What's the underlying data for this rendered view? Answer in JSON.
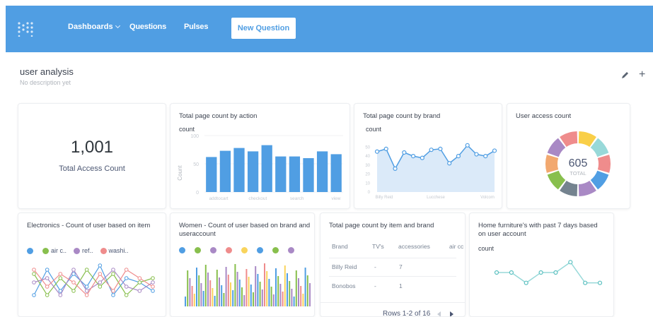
{
  "nav": {
    "dashboards": "Dashboards",
    "questions": "Questions",
    "pulses": "Pulses",
    "new_question": "New Question"
  },
  "dashboard": {
    "title": "user analysis",
    "description": "No description yet"
  },
  "icons": {
    "logo": "metabase-logo-icon",
    "edit": "pencil-icon",
    "add": "plus-icon"
  },
  "cards": {
    "access_count": {
      "value": "1,001",
      "label": "Total Access Count"
    },
    "page_by_action": {
      "title": "Total page count by action",
      "series_label": "count",
      "y_axis_label": "Count",
      "y_ticks": [
        "100",
        "50",
        "0"
      ],
      "x_ticks": [
        "addtocart",
        "checkout",
        "search",
        "view"
      ],
      "values": [
        62,
        73,
        78,
        72,
        83,
        63,
        63,
        60,
        72,
        67
      ]
    },
    "page_by_brand": {
      "title": "Total page count by brand",
      "series_label": "count",
      "y_ticks": [
        "50",
        "40",
        "30",
        "20",
        "10",
        "0"
      ],
      "x_ticks": [
        "Billy Reid",
        "Lucchese",
        "Volcom"
      ],
      "values": [
        45,
        48,
        26,
        44,
        40,
        38,
        47,
        48,
        32,
        40,
        52,
        42,
        40,
        46
      ]
    },
    "user_access": {
      "title": "User access count",
      "total": "605",
      "total_label": "TOTAL",
      "segment_colors": [
        "#f9cf48",
        "#98d9d9",
        "#ef8c8c",
        "#509ee3",
        "#a989c5",
        "#74838f",
        "#88bf4d",
        "#f2a86f",
        "#a989c5",
        "#ef8c8c"
      ]
    },
    "electronics": {
      "title": "Electronics - Count of user based on item",
      "legend": [
        {
          "label": "",
          "color": "#509ee3"
        },
        {
          "label": "air c..",
          "color": "#88bf4d"
        },
        {
          "label": "ref..",
          "color": "#a989c5"
        },
        {
          "label": "washi..",
          "color": "#ef8c8c"
        }
      ]
    },
    "women": {
      "title": "Women - Count of user based on brand and useraccount",
      "legend": [
        {
          "label": "",
          "color": "#509ee3"
        },
        {
          "label": "",
          "color": "#88bf4d"
        },
        {
          "label": "",
          "color": "#a989c5"
        },
        {
          "label": "",
          "color": "#ef8c8c"
        },
        {
          "label": "",
          "color": "#f9d45c"
        },
        {
          "label": "",
          "color": "#509ee3"
        },
        {
          "label": "",
          "color": "#88bf4d"
        },
        {
          "label": "",
          "color": "#a989c5"
        }
      ]
    },
    "item_brand_table": {
      "title": "Total page count by item and brand",
      "columns": [
        "Brand",
        "TV's",
        "accessories",
        "air cc"
      ],
      "rows": [
        [
          "Billy Reid",
          "-",
          "7",
          ""
        ],
        [
          "Bonobos",
          "-",
          "1",
          ""
        ]
      ],
      "pager": "Rows 1-2 of 16"
    },
    "furniture": {
      "title": "Home furniture's with past 7 days based on user account",
      "series_label": "count",
      "values": [
        3,
        3,
        2,
        3,
        3,
        4,
        2,
        2
      ]
    }
  }
}
